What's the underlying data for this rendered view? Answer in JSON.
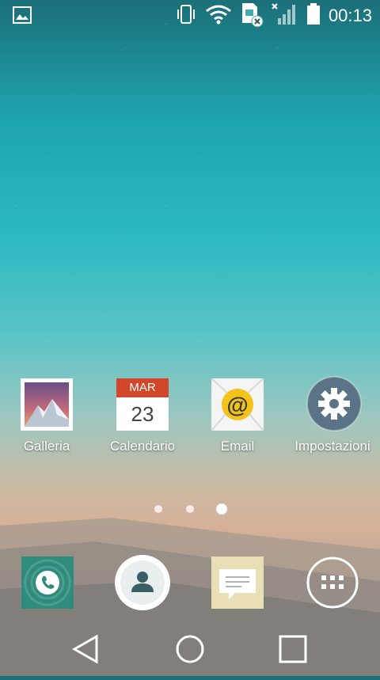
{
  "statusbar": {
    "time": "00:13",
    "icons": [
      "image-notification-icon",
      "vibrate-icon",
      "wifi-icon",
      "sim-missing-icon",
      "no-signal-icon",
      "battery-icon"
    ]
  },
  "home": {
    "apps": [
      {
        "label": "Galleria",
        "icon": "gallery-icon"
      },
      {
        "label": "Calendario",
        "icon": "calendar-icon",
        "month": "MAR",
        "day": "23"
      },
      {
        "label": "Email",
        "icon": "email-icon",
        "glyph": "@"
      },
      {
        "label": "Impostazioni",
        "icon": "settings-icon"
      }
    ],
    "page_indicator": {
      "count": 3,
      "active_index": 2
    }
  },
  "dock": {
    "items": [
      {
        "name": "phone-icon"
      },
      {
        "name": "contacts-icon"
      },
      {
        "name": "messages-icon"
      },
      {
        "name": "apps-drawer-icon"
      }
    ]
  },
  "navbar": {
    "buttons": [
      "back-icon",
      "home-icon",
      "recents-icon"
    ]
  },
  "colors": {
    "calendar_red": "#d2472a",
    "email_yellow": "#f3c21b",
    "settings_bg": "#5b7386",
    "phone_green": "#2f8c7c"
  }
}
